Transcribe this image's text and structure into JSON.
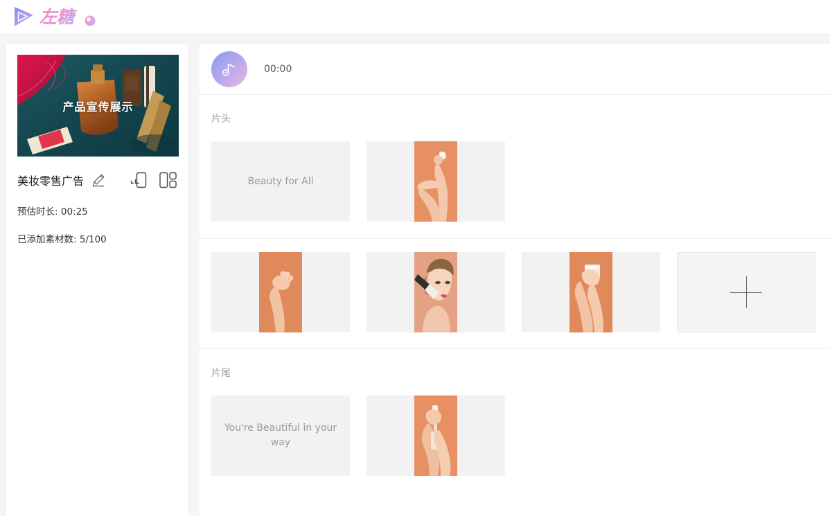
{
  "header": {
    "logo_icon": "play-triangle-logo-icon",
    "brand_name": "左糖",
    "brand_colors": {
      "icon_gradient_start": "#7f8ff4",
      "icon_gradient_end": "#d9a8e8",
      "text_gradient_start": "#f78fc2",
      "text_gradient_end": "#c9a8f0"
    }
  },
  "sidebar": {
    "thumbnail": {
      "overlay_text": "产品宣传展示",
      "alt": "cosmetics flat lay on teal velvet with perfume bottle, lipstick and brushes"
    },
    "project_title": "美妆零售广告",
    "edit_icon": "pencil-icon",
    "aspect_icon": "phone-aspect-ratio-icon",
    "layout_icon": "layout-grid-icon",
    "duration_label": "预估时长:",
    "duration_value": "00:25",
    "materials_label": "已添加素材数:",
    "materials_value": "5/100"
  },
  "main": {
    "music": {
      "icon": "music-note-icon",
      "time": "00:00"
    },
    "sections": [
      {
        "title": "片头",
        "tiles": [
          {
            "kind": "text",
            "text": "Beauty for All"
          },
          {
            "kind": "media",
            "alt": "hand holding white cosmetic applicator on peach background"
          }
        ]
      },
      {
        "title": "",
        "tiles": [
          {
            "kind": "media",
            "alt": "raised hand on peach background"
          },
          {
            "kind": "media",
            "alt": "woman applying foundation with brush"
          },
          {
            "kind": "media",
            "alt": "hands holding cream jar on peach background"
          },
          {
            "kind": "add",
            "text": ""
          }
        ]
      },
      {
        "title": "片尾",
        "tiles": [
          {
            "kind": "text",
            "text": "You're Beautiful in your way"
          },
          {
            "kind": "media",
            "alt": "hands holding serum dropper bottle on peach background"
          }
        ]
      }
    ]
  }
}
